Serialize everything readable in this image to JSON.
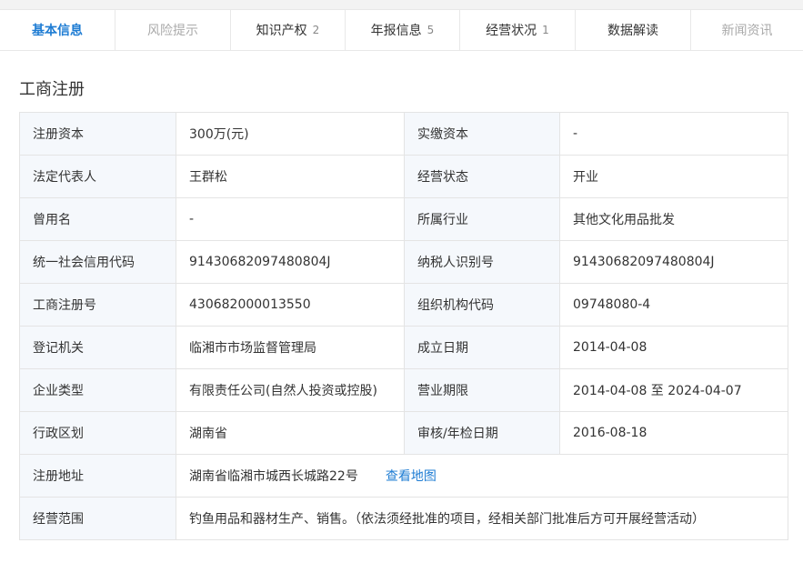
{
  "tabs": [
    {
      "label": "基本信息",
      "count": "",
      "state": "active"
    },
    {
      "label": "风险提示",
      "count": "",
      "state": "disabled"
    },
    {
      "label": "知识产权",
      "count": "2",
      "state": "normal"
    },
    {
      "label": "年报信息",
      "count": "5",
      "state": "normal"
    },
    {
      "label": "经营状况",
      "count": "1",
      "state": "normal"
    },
    {
      "label": "数据解读",
      "count": "",
      "state": "normal"
    },
    {
      "label": "新闻资讯",
      "count": "",
      "state": "disabled"
    }
  ],
  "section": {
    "title": "工商注册"
  },
  "rows": [
    {
      "l1": "注册资本",
      "v1": "300万(元)",
      "l2": "实缴资本",
      "v2": "-"
    },
    {
      "l1": "法定代表人",
      "v1": "王群松",
      "l2": "经营状态",
      "v2": "开业"
    },
    {
      "l1": "曾用名",
      "v1": "-",
      "l2": "所属行业",
      "v2": "其他文化用品批发"
    },
    {
      "l1": "统一社会信用代码",
      "v1": "91430682097480804J",
      "l2": "纳税人识别号",
      "v2": "91430682097480804J"
    },
    {
      "l1": "工商注册号",
      "v1": "430682000013550",
      "l2": "组织机构代码",
      "v2": "09748080-4"
    },
    {
      "l1": "登记机关",
      "v1": "临湘市市场监督管理局",
      "l2": "成立日期",
      "v2": "2014-04-08"
    },
    {
      "l1": "企业类型",
      "v1": "有限责任公司(自然人投资或控股)",
      "l2": "营业期限",
      "v2": "2014-04-08 至 2024-04-07"
    },
    {
      "l1": "行政区划",
      "v1": "湖南省",
      "l2": "审核/年检日期",
      "v2": "2016-08-18"
    }
  ],
  "address": {
    "label": "注册地址",
    "value": "湖南省临湘市城西长城路22号",
    "map_link": "查看地图"
  },
  "scope": {
    "label": "经营范围",
    "value": "钓鱼用品和器材生产、销售。（依法须经批准的项目，经相关部门批准后方可开展经营活动）"
  },
  "colors": {
    "accent": "#1e7cd3",
    "label_bg": "#f5f8fc",
    "border": "#e4e4e4"
  }
}
